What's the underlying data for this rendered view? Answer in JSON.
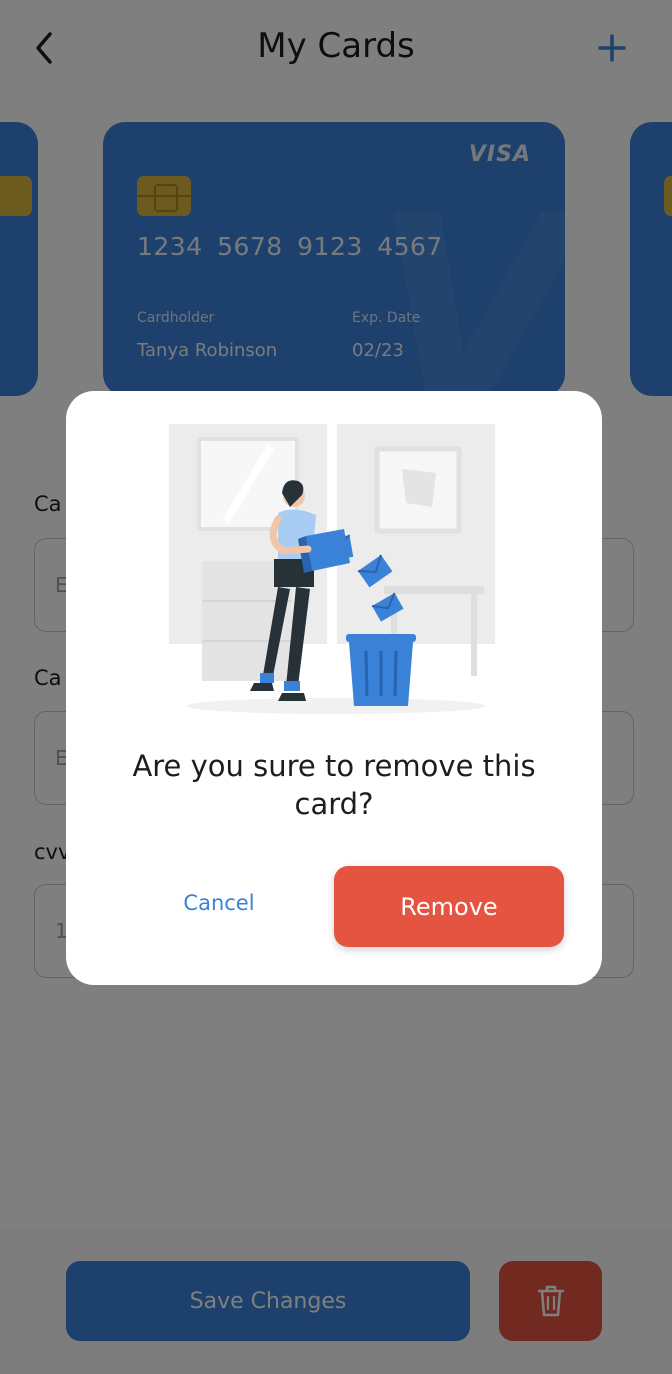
{
  "header": {
    "title": "My Cards",
    "back_icon": "chevron-left-icon",
    "add_icon": "plus-icon"
  },
  "cards": {
    "main": {
      "brand": "VISA",
      "number": "1234  5678  9123  4567",
      "cardholder_label": "Cardholder",
      "cardholder_value": "Tanya Robinson",
      "exp_label": "Exp. Date",
      "exp_value": "02/23"
    }
  },
  "form": {
    "label_1": "Ca",
    "input_1_placeholder": "E",
    "label_2": "Ca",
    "input_2_placeholder": "E",
    "label_3": "cvv",
    "input_3_placeholder": "1"
  },
  "bottom": {
    "save_label": "Save Changes",
    "delete_icon": "trash-icon"
  },
  "dialog": {
    "message": "Are you sure to remove this card?",
    "cancel_label": "Cancel",
    "remove_label": "Remove"
  },
  "colors": {
    "accent_blue": "#3a82d8",
    "danger_red": "#e55440",
    "overlay": "rgba(0,0,0,0.5)"
  }
}
